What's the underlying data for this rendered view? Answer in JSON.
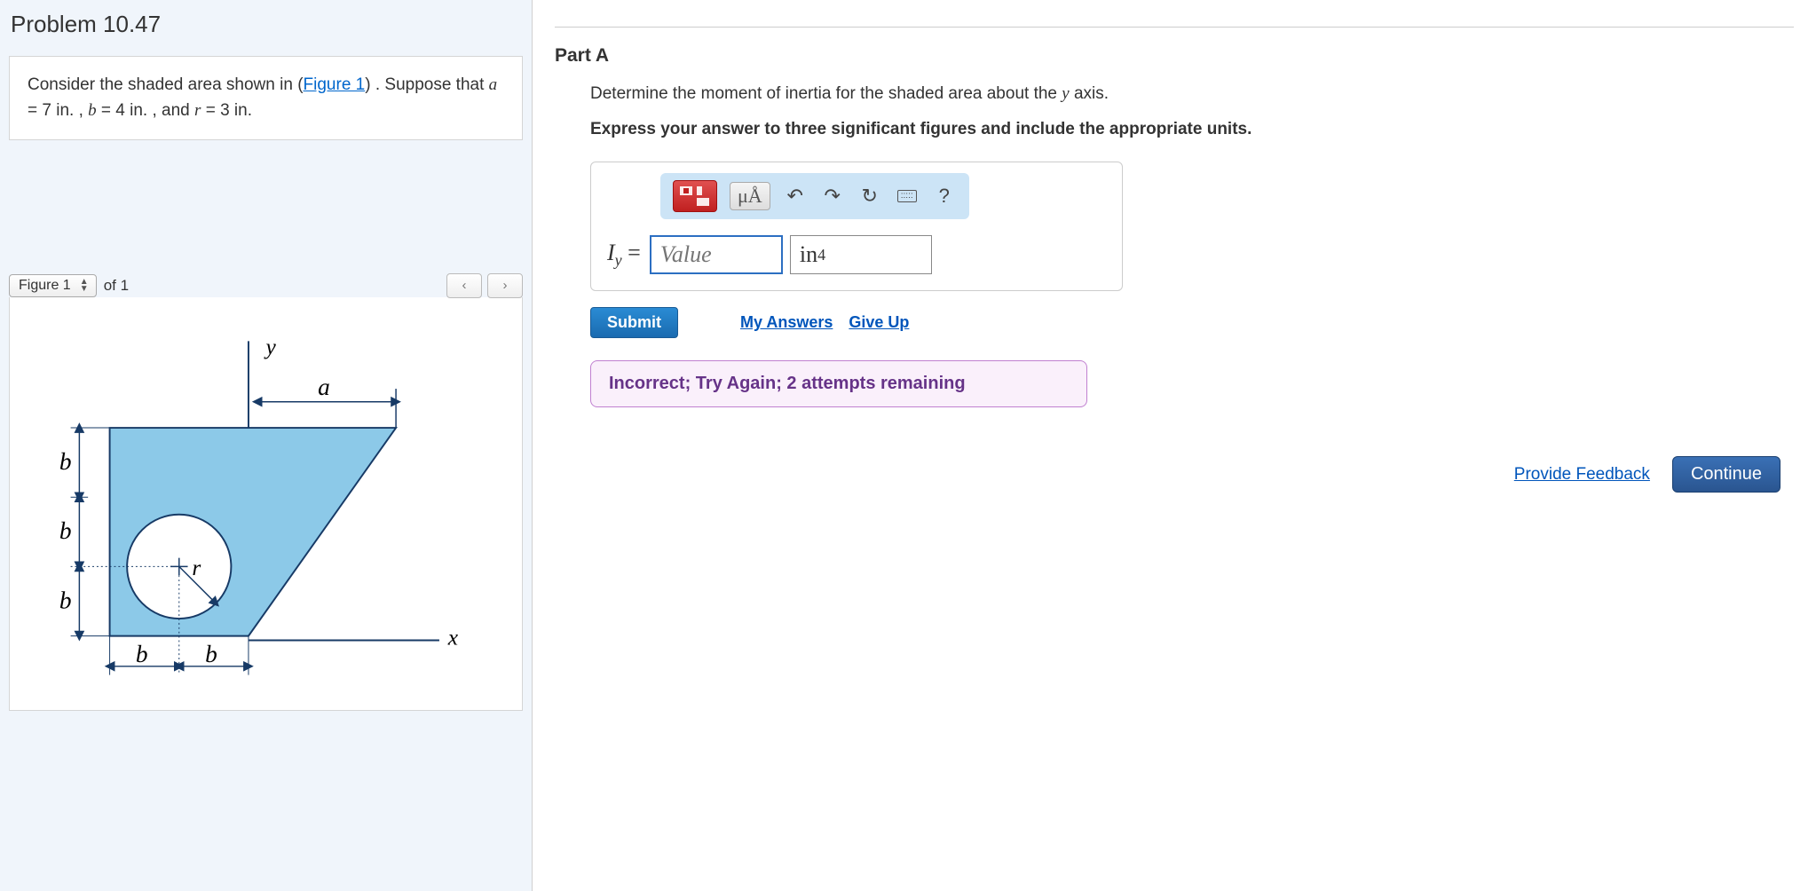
{
  "problem": {
    "title": "Problem 10.47",
    "intro_pre": "Consider the shaded area shown in (",
    "figure_link": "Figure 1",
    "intro_post": ") . Suppose that ",
    "params_a_var": "a",
    "params_a_val": " = 7  in. , ",
    "params_b_var": "b",
    "params_b_val": " = 4  in. , and ",
    "params_r_var": "r",
    "params_r_val": " = 3  in."
  },
  "figure": {
    "selector_label": "Figure 1",
    "of_text": "of 1",
    "prev": "<",
    "next": ">",
    "labels": {
      "y": "y",
      "x": "x",
      "a": "a",
      "b": "b",
      "r": "r"
    }
  },
  "part": {
    "title": "Part A",
    "question_pre": "Determine the moment of inertia for the shaded area about the ",
    "question_var": "y",
    "question_post": " axis.",
    "instruction": "Express your answer to three significant figures and include the appropriate units."
  },
  "toolbar": {
    "special": "μÅ",
    "undo": "↶",
    "redo": "↷",
    "reset": "↻",
    "keyboard": "⌨",
    "help": "?"
  },
  "answer": {
    "lhs_var": "I",
    "lhs_sub": "y",
    "equals": " = ",
    "value_placeholder": "Value",
    "unit_base": "in",
    "unit_exp": "4"
  },
  "actions": {
    "submit": "Submit",
    "my_answers": "My Answers",
    "give_up": "Give Up"
  },
  "feedback": {
    "message": "Incorrect; Try Again; 2 attempts remaining"
  },
  "footer": {
    "provide_feedback": "Provide Feedback",
    "continue": "Continue"
  }
}
